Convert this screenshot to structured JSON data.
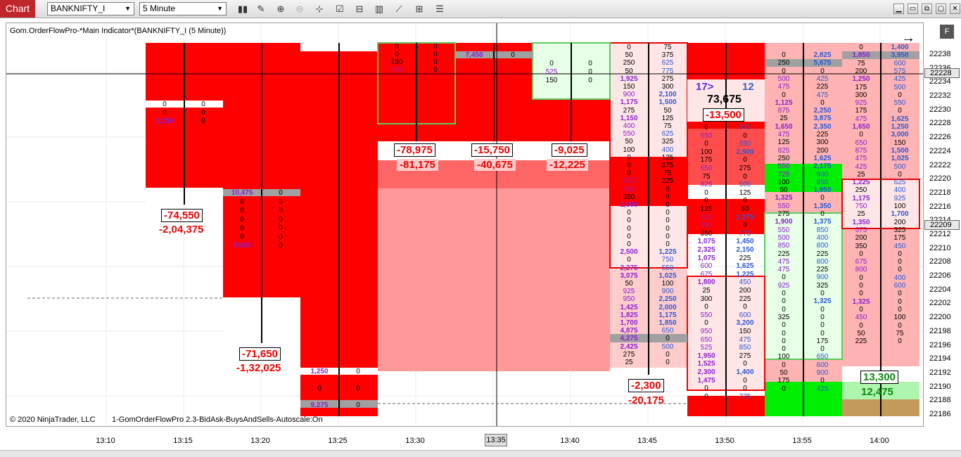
{
  "toolbar": {
    "tab": "Chart",
    "instrument": "BANKNIFTY_I",
    "interval": "5 Minute",
    "icons": [
      "bar-type-icon",
      "draw-icon",
      "zoom-in-icon",
      "zoom-out-icon",
      "crosshair-icon",
      "properties-icon",
      "data-box-icon",
      "indicators-icon",
      "strategies-icon",
      "chart-trader-icon",
      "more-icon"
    ]
  },
  "chart": {
    "indicator_title": "Gom.OrderFlowPro-*Main Indicator*(BANKNIFTY_I (5 Minute))",
    "copyright": "© 2020 NinjaTrader, LLC",
    "strategy_label": "1-GomOrderFlowPro 2.3-BidAsk-BuysAndSells-Autoscale:On",
    "f_button": "F",
    "price_labels": [
      "22238",
      "22236",
      "22234",
      "22232",
      "22230",
      "22228",
      "22226",
      "22224",
      "22222",
      "22220",
      "22218",
      "22216",
      "22214",
      "22212",
      "22210",
      "22208",
      "22206",
      "22204",
      "22202",
      "22200",
      "22198",
      "22196",
      "22194",
      "22192",
      "22190",
      "22188",
      "22186"
    ],
    "price_tags": [
      "22228",
      "22209"
    ],
    "time_labels": [
      "13:10",
      "13:15",
      "13:20",
      "13:25",
      "13:30",
      "13:35",
      "13:40",
      "13:45",
      "13:50",
      "13:55",
      "14:00"
    ],
    "time_cursor": "13:35",
    "colors": {
      "strong_sell": "#ff0000",
      "light_sell": "#ffb3b3",
      "pale": "#ffe6e6",
      "buy": "#00ee00",
      "pale_buy": "#e6ffe6",
      "poc": "#a0a0a0"
    }
  },
  "bar_stats": [
    {
      "delta": "-74,550",
      "cum": "-2,04,375"
    },
    {
      "delta": "-71,650",
      "cum": "-1,32,025"
    },
    {
      "delta": "-78,975",
      "cum": "-81,175"
    },
    {
      "delta": "-15,750",
      "cum": "-40,675"
    },
    {
      "delta": "-9,025",
      "cum": "-12,225"
    },
    {
      "delta": "-2,300",
      "cum": "-20,175"
    },
    {
      "delta": "-13,500",
      "ratio": "17>",
      "ratio2": "12",
      "vol": "73,675"
    },
    {
      "delta": "13,300",
      "cum": "12,475"
    }
  ],
  "cells": {
    "c1": [
      [
        "0",
        "0"
      ],
      [
        "0",
        "0"
      ],
      [
        "2,250",
        "0"
      ]
    ],
    "c2": [
      [
        "10,475",
        "0"
      ],
      [
        "0",
        "0"
      ],
      [
        "0",
        "0"
      ],
      [
        "0",
        "0"
      ],
      [
        "0",
        "0"
      ],
      [
        "0",
        "0"
      ],
      [
        "9,900",
        "0"
      ]
    ],
    "c3": [
      [
        "1,250",
        "0"
      ],
      [
        "0",
        "0"
      ],
      [
        "9,275",
        "0"
      ]
    ],
    "c4": [
      [
        "0",
        "0"
      ],
      [
        "0",
        "0"
      ],
      [
        "150",
        "0"
      ],
      [
        "400",
        "0"
      ]
    ],
    "c5": [
      [
        "7,450",
        "0"
      ]
    ],
    "c6": [
      [
        "0",
        "0"
      ],
      [
        "525",
        "0"
      ],
      [
        "150",
        "0"
      ]
    ],
    "c7": [
      [
        "0",
        "75"
      ],
      [
        "50",
        "375"
      ],
      [
        "250",
        "625"
      ],
      [
        "50",
        "775"
      ],
      [
        "1,925",
        "275"
      ],
      [
        "150",
        "300"
      ],
      [
        "900",
        "2,100"
      ],
      [
        "1,175",
        "1,500"
      ],
      [
        "275",
        "50"
      ],
      [
        "1,150",
        "125"
      ],
      [
        "400",
        "75"
      ],
      [
        "550",
        "625"
      ],
      [
        "50",
        "325"
      ],
      [
        "100",
        "400"
      ],
      [
        "0",
        "125"
      ],
      [
        "0",
        "375"
      ],
      [
        "0",
        "75"
      ],
      [
        "675",
        "225"
      ],
      [
        "400",
        "0"
      ],
      [
        "350",
        "0"
      ],
      [
        "2,000",
        "0"
      ],
      [
        "0",
        "0"
      ],
      [
        "0",
        "0"
      ],
      [
        "0",
        "0"
      ],
      [
        "0",
        "0"
      ],
      [
        "0",
        "0"
      ],
      [
        "2,500",
        "1,225"
      ],
      [
        "0",
        "750"
      ],
      [
        "2,275",
        "550"
      ],
      [
        "3,075",
        "1,025"
      ],
      [
        "50",
        "100"
      ],
      [
        "925",
        "900"
      ],
      [
        "950",
        "2,250"
      ],
      [
        "1,425",
        "2,000"
      ],
      [
        "1,825",
        "1,175"
      ],
      [
        "1,700",
        "1,850"
      ],
      [
        "4,875",
        "650"
      ],
      [
        "4,275",
        "0"
      ],
      [
        "2,425",
        "500"
      ],
      [
        "275",
        "0"
      ],
      [
        "25",
        "0"
      ]
    ],
    "c8": [
      [
        "0",
        "975"
      ],
      [
        "550",
        "0"
      ],
      [
        "0",
        "950"
      ],
      [
        "100",
        "2,500"
      ],
      [
        "175",
        "0"
      ],
      [
        "650",
        "275"
      ],
      [
        "75",
        "0"
      ],
      [
        "825",
        "500"
      ],
      [
        "0",
        "125"
      ],
      [
        "0",
        "0"
      ],
      [
        "125",
        "50"
      ],
      [
        "425",
        "2,275"
      ],
      [
        "550",
        "0"
      ],
      [
        "350",
        "775"
      ],
      [
        "1,075",
        "1,450"
      ],
      [
        "2,325",
        "2,150"
      ],
      [
        "1,075",
        "225"
      ],
      [
        "600",
        "1,625"
      ],
      [
        "675",
        "1,225"
      ],
      [
        "1,800",
        "450"
      ],
      [
        "25",
        "200"
      ],
      [
        "300",
        "225"
      ],
      [
        "0",
        "0"
      ],
      [
        "550",
        "600"
      ],
      [
        "0",
        "3,200"
      ],
      [
        "950",
        "150"
      ],
      [
        "650",
        "475"
      ],
      [
        "525",
        "850"
      ],
      [
        "1,950",
        "275"
      ],
      [
        "1,525",
        "0"
      ],
      [
        "2,300",
        "1,400"
      ],
      [
        "1,475",
        "0"
      ],
      [
        "0",
        "0"
      ],
      [
        "0",
        "775"
      ]
    ],
    "c9": [
      [
        "0",
        "2,825"
      ],
      [
        "250",
        "5,675"
      ],
      [
        "0",
        "0"
      ],
      [
        "500",
        "425"
      ],
      [
        "475",
        "225"
      ],
      [
        "0",
        "475"
      ],
      [
        "1,125",
        "0"
      ],
      [
        "875",
        "2,250"
      ],
      [
        "25",
        "3,875"
      ],
      [
        "1,650",
        "2,350"
      ],
      [
        "475",
        "225"
      ],
      [
        "125",
        "300"
      ],
      [
        "825",
        "200"
      ],
      [
        "250",
        "1,625"
      ],
      [
        "550",
        "2,175"
      ],
      [
        "725",
        "900"
      ],
      [
        "100",
        "850"
      ],
      [
        "50",
        "1,950"
      ],
      [
        "1,325",
        "0"
      ],
      [
        "550",
        "1,350"
      ],
      [
        "275",
        "0"
      ],
      [
        "1,900",
        "1,375"
      ],
      [
        "550",
        "850"
      ],
      [
        "500",
        "400"
      ],
      [
        "850",
        "800"
      ],
      [
        "225",
        "225"
      ],
      [
        "475",
        "800"
      ],
      [
        "475",
        "225"
      ],
      [
        "0",
        "900"
      ],
      [
        "925",
        "325"
      ],
      [
        "0",
        "0"
      ],
      [
        "0",
        "1,325"
      ],
      [
        "0",
        "0"
      ],
      [
        "325",
        "0"
      ],
      [
        "0",
        "0"
      ],
      [
        "0",
        "0"
      ],
      [
        "0",
        "175"
      ],
      [
        "0",
        "0"
      ],
      [
        "100",
        "650"
      ],
      [
        "0",
        "600"
      ],
      [
        "50",
        "900"
      ],
      [
        "175",
        "0"
      ],
      [
        "0",
        "425"
      ]
    ],
    "c10": [
      [
        "0",
        "1,400"
      ],
      [
        "1,850",
        "3,950"
      ],
      [
        "75",
        "600"
      ],
      [
        "200",
        "575"
      ],
      [
        "1,250",
        "425"
      ],
      [
        "175",
        "500"
      ],
      [
        "300",
        "0"
      ],
      [
        "925",
        "550"
      ],
      [
        "175",
        "0"
      ],
      [
        "475",
        "1,625"
      ],
      [
        "1,650",
        "1,250"
      ],
      [
        "0",
        "3,000"
      ],
      [
        "650",
        "150"
      ],
      [
        "875",
        "1,500"
      ],
      [
        "475",
        "1,025"
      ],
      [
        "425",
        "500"
      ],
      [
        "25",
        "0"
      ],
      [
        "1,225",
        "625"
      ],
      [
        "250",
        "400"
      ],
      [
        "1,175",
        "925"
      ],
      [
        "750",
        "100"
      ],
      [
        "25",
        "1,700"
      ],
      [
        "1,350",
        "200"
      ],
      [
        "575",
        "325"
      ],
      [
        "200",
        "175"
      ],
      [
        "350",
        "450"
      ],
      [
        "0",
        "0"
      ],
      [
        "675",
        "0"
      ],
      [
        "800",
        "0"
      ],
      [
        "0",
        "400"
      ],
      [
        "0",
        "600"
      ],
      [
        "0",
        "0"
      ],
      [
        "1,325",
        "0"
      ],
      [
        "0",
        "0"
      ],
      [
        "450",
        "100"
      ],
      [
        "0",
        "0"
      ],
      [
        "50",
        "75"
      ],
      [
        "225",
        "0"
      ]
    ]
  }
}
